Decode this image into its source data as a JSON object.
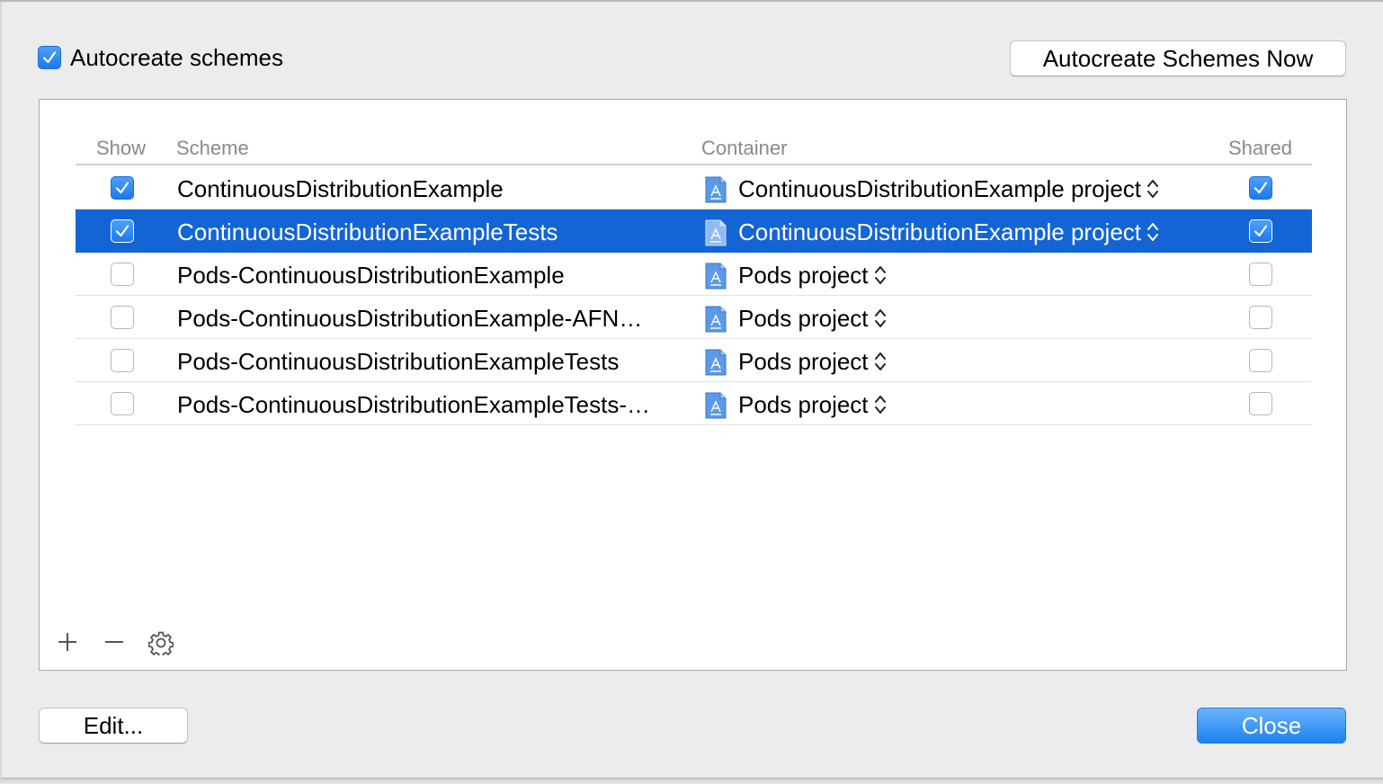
{
  "autocreate": {
    "label": "Autocreate schemes",
    "checked": true
  },
  "buttons": {
    "autocreate_now": "Autocreate Schemes Now",
    "edit": "Edit...",
    "close": "Close"
  },
  "table": {
    "headers": {
      "show": "Show",
      "scheme": "Scheme",
      "container": "Container",
      "shared": "Shared"
    },
    "rows": [
      {
        "show": true,
        "scheme": "ContinuousDistributionExample",
        "container": "ContinuousDistributionExample project",
        "shared": true,
        "selected": false
      },
      {
        "show": true,
        "scheme": "ContinuousDistributionExampleTests",
        "container": "ContinuousDistributionExample project",
        "shared": true,
        "selected": true
      },
      {
        "show": false,
        "scheme": "Pods-ContinuousDistributionExample",
        "container": "Pods project",
        "shared": false,
        "selected": false
      },
      {
        "show": false,
        "scheme": "Pods-ContinuousDistributionExample-AFN…",
        "container": "Pods project",
        "shared": false,
        "selected": false
      },
      {
        "show": false,
        "scheme": "Pods-ContinuousDistributionExampleTests",
        "container": "Pods project",
        "shared": false,
        "selected": false
      },
      {
        "show": false,
        "scheme": "Pods-ContinuousDistributionExampleTests-…",
        "container": "Pods project",
        "shared": false,
        "selected": false
      }
    ]
  },
  "toolbar": {
    "add_icon": "plus-icon",
    "remove_icon": "minus-icon",
    "settings_icon": "gear-icon"
  },
  "colors": {
    "selection": "#1365d6",
    "accent": "#1a7af1"
  }
}
